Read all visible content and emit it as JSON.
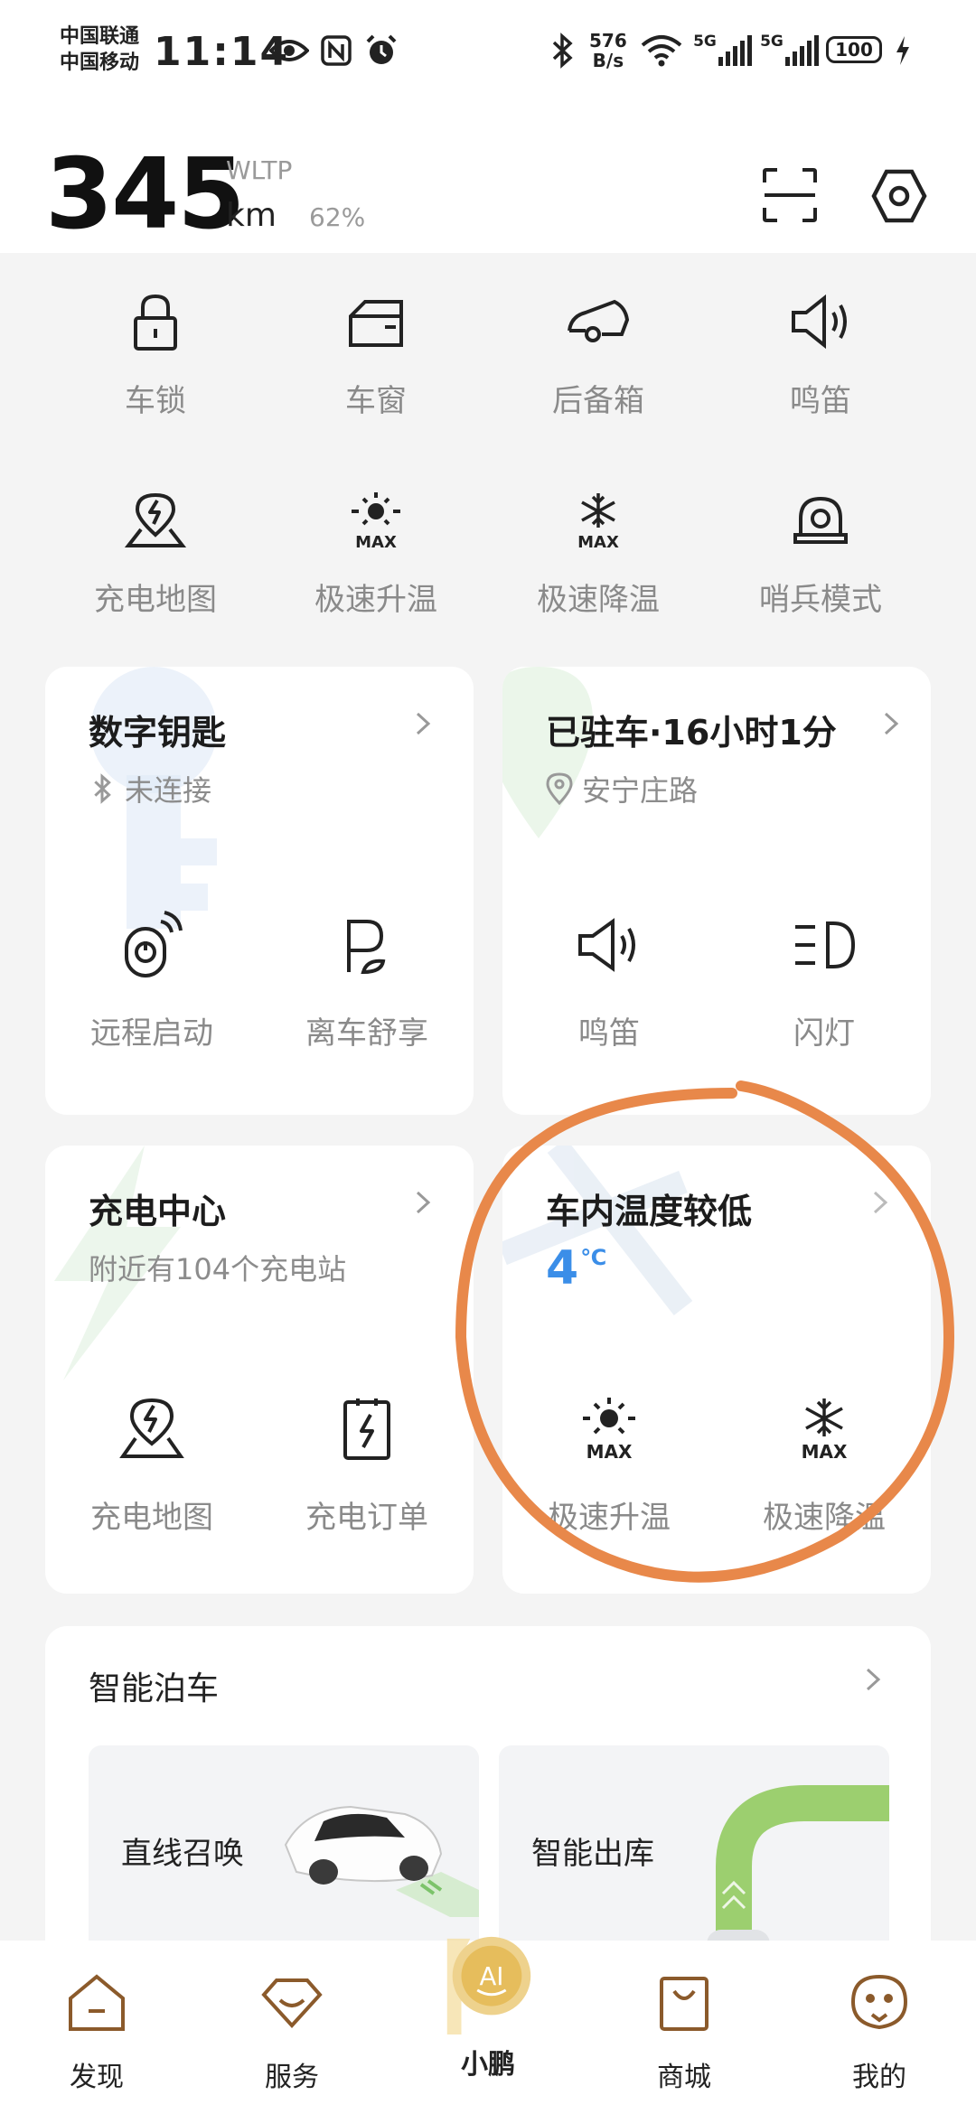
{
  "status_bar": {
    "carrier1": "中国联通",
    "carrier2": "中国移动",
    "time": "11:14",
    "net_speed_value": "576",
    "net_speed_unit": "B/s",
    "signal1_label": "5G",
    "signal2_label": "5G",
    "battery": "100",
    "icons": [
      "eye-icon",
      "nfc-icon",
      "alarm-icon",
      "bluetooth-icon",
      "wifi-icon",
      "signal-icon",
      "charging-bolt-icon"
    ]
  },
  "header": {
    "range_value": "345",
    "range_unit": "km",
    "range_standard": "WLTP",
    "battery_percent": "62%",
    "icons": [
      "scan-icon",
      "settings-hexagon-icon"
    ]
  },
  "quick_controls": [
    {
      "label": "车锁",
      "icon": "lock-icon"
    },
    {
      "label": "车窗",
      "icon": "car-window-icon"
    },
    {
      "label": "后备箱",
      "icon": "trunk-icon"
    },
    {
      "label": "鸣笛",
      "icon": "horn-icon"
    },
    {
      "label": "充电地图",
      "icon": "charging-map-icon"
    },
    {
      "label": "极速升温",
      "icon": "max-heat-icon"
    },
    {
      "label": "极速降温",
      "icon": "max-cool-icon"
    },
    {
      "label": "哨兵模式",
      "icon": "sentry-icon"
    }
  ],
  "cards": {
    "digital_key": {
      "title": "数字钥匙",
      "status": "未连接",
      "actions": [
        {
          "label": "远程启动",
          "icon": "remote-start-icon"
        },
        {
          "label": "离车舒享",
          "icon": "leave-car-comfort-icon"
        }
      ]
    },
    "parked": {
      "title": "已驻车·16小时1分",
      "location": "安宁庄路",
      "actions": [
        {
          "label": "鸣笛",
          "icon": "horn-icon"
        },
        {
          "label": "闪灯",
          "icon": "headlight-flash-icon"
        }
      ]
    },
    "charging": {
      "title": "充电中心",
      "subtitle": "附近有104个充电站",
      "actions": [
        {
          "label": "充电地图",
          "icon": "charging-map-icon"
        },
        {
          "label": "充电订单",
          "icon": "charging-order-icon"
        }
      ]
    },
    "temperature": {
      "title": "车内温度较低",
      "temp_value": "4",
      "temp_unit": "℃",
      "actions": [
        {
          "label": "极速升温",
          "icon": "max-heat-icon"
        },
        {
          "label": "极速降温",
          "icon": "max-cool-icon"
        }
      ]
    }
  },
  "smart_parking": {
    "title": "智能泊车",
    "tiles": [
      {
        "label": "直线召唤"
      },
      {
        "label": "智能出库"
      }
    ]
  },
  "bottom_nav": [
    {
      "label": "发现",
      "icon": "home-icon"
    },
    {
      "label": "服务",
      "icon": "service-icon"
    },
    {
      "label": "小鹏",
      "icon": "ai-assistant-icon",
      "badge": "AI"
    },
    {
      "label": "商城",
      "icon": "shop-bag-icon"
    },
    {
      "label": "我的",
      "icon": "profile-face-icon"
    }
  ],
  "colors": {
    "accent_brown": "#8b5a2b",
    "temp_blue": "#3b8ee8",
    "annotation_orange": "#e8884a",
    "ai_gold": "#d9a441"
  }
}
